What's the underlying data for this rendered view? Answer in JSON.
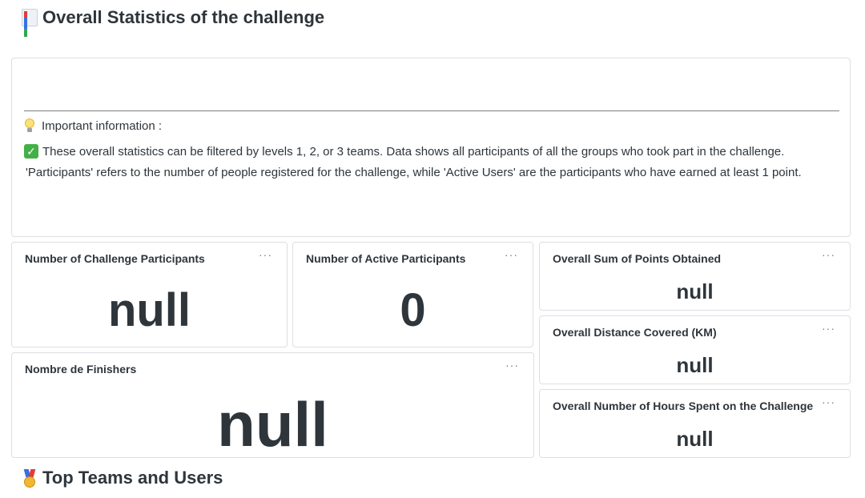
{
  "sections": {
    "overall_title": "Overall Statistics of the challenge",
    "top_title": "Top Teams and Users"
  },
  "info": {
    "heading": "Important information :",
    "line1": "These overall statistics can be filtered by levels 1, 2, or 3 teams. Data shows all participants of all the groups who took part in the challenge.",
    "line2": "'Participants' refers to the number of people registered for the challenge, while 'Active Users' are the participants who have earned at least 1 point."
  },
  "more_label": "···",
  "stats": {
    "participants": {
      "title": "Number of Challenge Participants",
      "value": "null"
    },
    "active": {
      "title": "Number of Active Participants",
      "value": "0"
    },
    "finishers": {
      "title": "Nombre de Finishers",
      "value": "null"
    },
    "points": {
      "title": "Overall Sum of Points Obtained",
      "value": "null"
    },
    "distance": {
      "title": "Overall Distance Covered (KM)",
      "value": "null"
    },
    "hours": {
      "title": "Overall Number of Hours Spent on the Challenge",
      "value": "null"
    }
  },
  "icons": {
    "overall_title": "bar-chart-icon",
    "top_title": "medal-icon",
    "info_heading": "light-bulb-icon",
    "info_line1": "check-mark-icon",
    "card_menu": "more-options-icon"
  },
  "colors": {
    "text": "#2e353b",
    "border": "#dcdfe3",
    "check": "#43b047"
  }
}
